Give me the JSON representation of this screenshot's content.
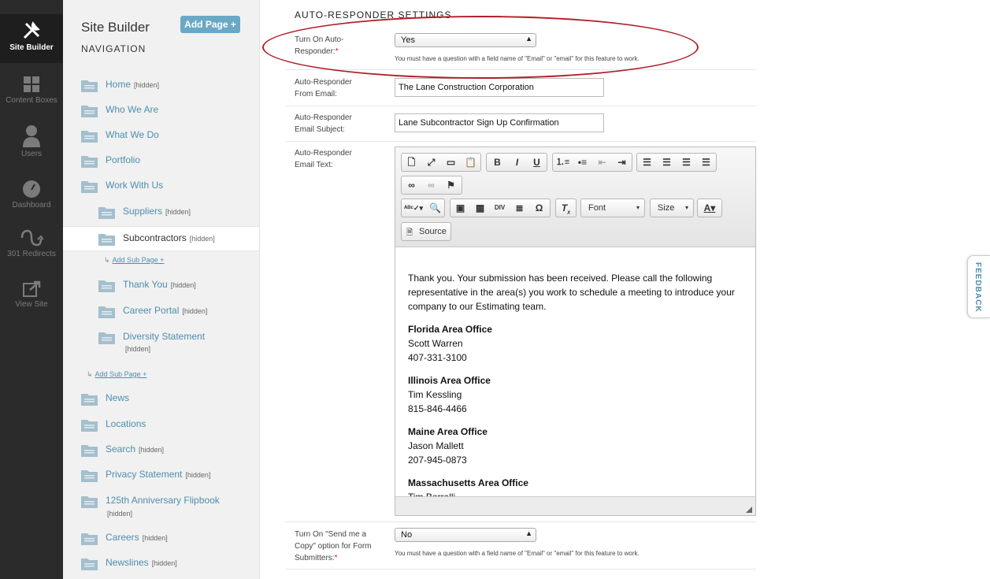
{
  "rail": {
    "items": [
      {
        "label": "Site Builder",
        "icon": "tools-icon"
      },
      {
        "label": "Content Boxes",
        "icon": "grid-icon"
      },
      {
        "label": "Users",
        "icon": "user-icon"
      },
      {
        "label": "Dashboard",
        "icon": "gauge-icon"
      },
      {
        "label": "301 Redirects",
        "icon": "redirect-icon"
      },
      {
        "label": "View Site",
        "icon": "external-link-icon"
      }
    ]
  },
  "nav": {
    "title": "Site Builder",
    "add_page_label": "Add Page +",
    "subtitle": "NAVIGATION",
    "items": [
      {
        "label": "Home",
        "hidden": "[hidden]"
      },
      {
        "label": "Who We Are",
        "hidden": ""
      },
      {
        "label": "What We Do",
        "hidden": ""
      },
      {
        "label": "Portfolio",
        "hidden": ""
      },
      {
        "label": "Work With Us",
        "hidden": ""
      },
      {
        "label": "Suppliers",
        "hidden": "[hidden]"
      },
      {
        "label": "Subcontractors",
        "hidden": "[hidden]"
      },
      {
        "label": "Thank You",
        "hidden": "[hidden]"
      },
      {
        "label": "Career Portal",
        "hidden": "[hidden]"
      },
      {
        "label": "Diversity Statement",
        "hidden": "[hidden]"
      },
      {
        "label": "News",
        "hidden": ""
      },
      {
        "label": "Locations",
        "hidden": ""
      },
      {
        "label": "Search",
        "hidden": "[hidden]"
      },
      {
        "label": "Privacy Statement",
        "hidden": "[hidden]"
      },
      {
        "label": "125th Anniversary Flipbook",
        "hidden": "[hidden]"
      },
      {
        "label": "Careers",
        "hidden": "[hidden]"
      },
      {
        "label": "Newslines",
        "hidden": "[hidden]"
      }
    ],
    "add_sub_page_label": "Add Sub Page +"
  },
  "main": {
    "section_title": "AUTO-RESPONDER SETTINGS",
    "turn_on": {
      "label": "Turn On Auto-Responder:",
      "required": "*",
      "value": "Yes",
      "hint": "You must have a question with a field name of \"Email\" or \"email\" for this feature to work."
    },
    "from_email": {
      "label": "Auto-Responder From Email:",
      "value": "The Lane Construction Corporation"
    },
    "subject": {
      "label": "Auto-Responder Email Subject:",
      "value": "Lane Subcontractor Sign Up Confirmation"
    },
    "email_text": {
      "label": "Auto-Responder Email Text:"
    },
    "send_copy": {
      "label": "Turn On \"Send me a Copy\" option for Form Submitters:",
      "required": "*",
      "value": "No",
      "hint": "You must have a question with a field name of \"Email\" or \"email\" for this feature to work."
    }
  },
  "editor": {
    "font_label": "Font",
    "size_label": "Size",
    "source_label": "Source",
    "intro": "Thank you. Your submission has been received. Please call the following representative in the area(s) you work to schedule a meeting to introduce your company to our Estimating team.",
    "offices": [
      {
        "name": "Florida Area Office",
        "person": "Scott Warren",
        "phone": "407-331-3100"
      },
      {
        "name": "Illinois Area Office",
        "person": "Tim Kessling",
        "phone": "815-846-4466"
      },
      {
        "name": "Maine Area Office",
        "person": "Jason Mallett",
        "phone": "207-945-0873"
      },
      {
        "name": "Massachusetts Area Office",
        "person": "Tim Borrelli",
        "phone": ""
      }
    ]
  },
  "feedback_label": "FEEDBACK",
  "colors": {
    "accent": "#4d8eae",
    "rail": "#2b2b2b",
    "annotation": "#b01e2a"
  }
}
